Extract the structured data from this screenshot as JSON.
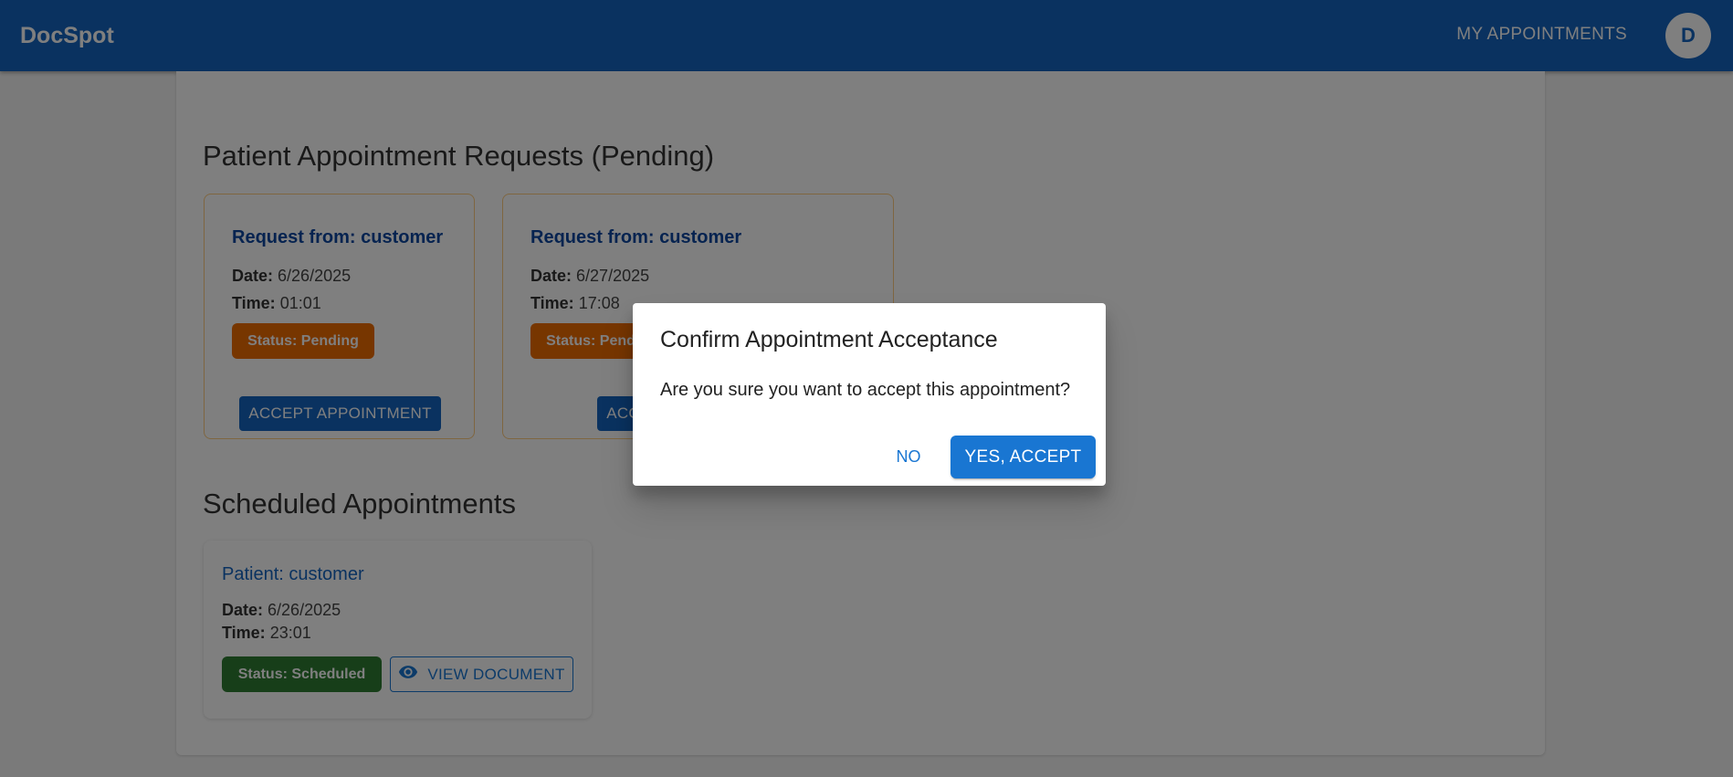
{
  "header": {
    "brand": "DocSpot",
    "nav_link": "MY APPOINTMENTS",
    "avatar_initial": "D"
  },
  "pending_section": {
    "title": "Patient Appointment Requests (Pending)",
    "cards": [
      {
        "heading": "Request from: customer",
        "date_label": "Date:",
        "date_value": "6/26/2025",
        "time_label": "Time:",
        "time_value": "01:01",
        "status": "Status: Pending",
        "button_label": "ACCEPT APPOINTMENT"
      },
      {
        "heading": "Request from: customer",
        "date_label": "Date:",
        "date_value": "6/27/2025",
        "time_label": "Time:",
        "time_value": "17:08",
        "status": "Status: Pending",
        "button_label": "ACCEPT APPOINTMENT"
      }
    ]
  },
  "scheduled_section": {
    "title": "Scheduled Appointments",
    "cards": [
      {
        "heading": "Patient: customer",
        "date_label": "Date:",
        "date_value": "6/26/2025",
        "time_label": "Time:",
        "time_value": "23:01",
        "status": "Status: Scheduled",
        "button_label": "VIEW DOCUMENT",
        "button_icon": "eye-icon"
      }
    ]
  },
  "dialog": {
    "title": "Confirm Appointment Acceptance",
    "message": "Are you sure you want to accept this appointment?",
    "no_label": "NO",
    "yes_label": "YES, ACCEPT"
  },
  "colors": {
    "appbar": "#1565c0",
    "pending": "#ef6c00",
    "scheduled": "#2e7d32",
    "primary": "#1976d2"
  }
}
